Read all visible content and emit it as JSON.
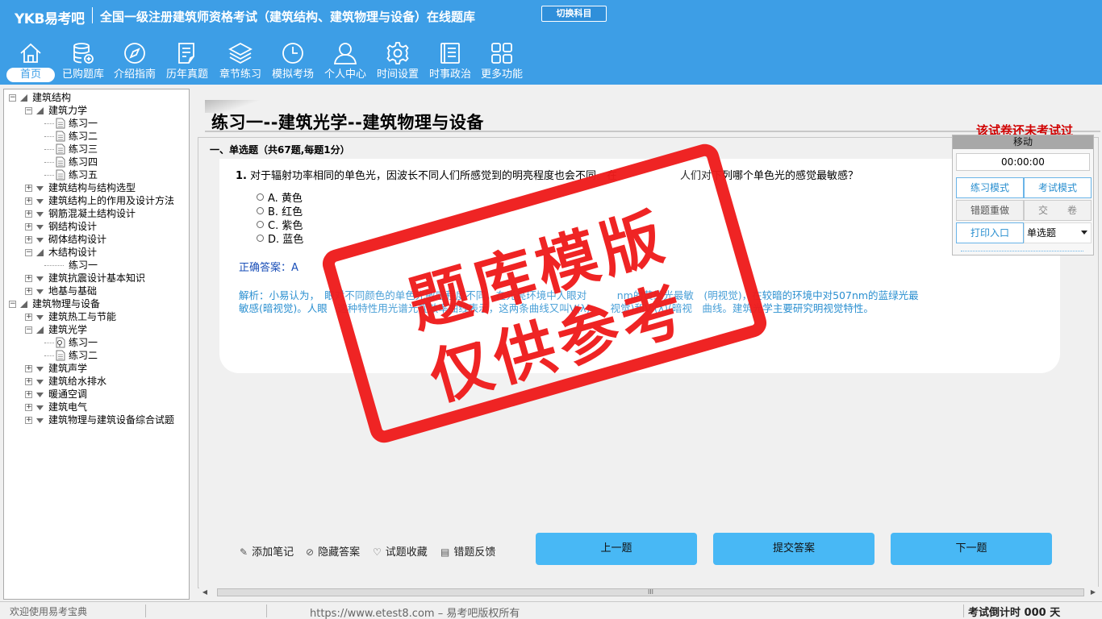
{
  "app": {
    "logo": "YKB易考吧",
    "title": "全国一级注册建筑师资格考试（建筑结构、建筑物理与设备）在线题库",
    "switch_label": "切换科目"
  },
  "nav": [
    {
      "label": "首页",
      "icon": "home-icon",
      "active": true
    },
    {
      "label": "已购题库",
      "icon": "database-icon"
    },
    {
      "label": "介绍指南",
      "icon": "compass-icon"
    },
    {
      "label": "历年真题",
      "icon": "document-list-icon"
    },
    {
      "label": "章节练习",
      "icon": "layers-icon"
    },
    {
      "label": "模拟考场",
      "icon": "clock-icon"
    },
    {
      "label": "个人中心",
      "icon": "user-icon"
    },
    {
      "label": "时间设置",
      "icon": "gear-icon"
    },
    {
      "label": "时事政治",
      "icon": "news-icon"
    },
    {
      "label": "更多功能",
      "icon": "grid-icon"
    }
  ],
  "tree": [
    {
      "label": "建筑结构",
      "level": 0,
      "expanded": true
    },
    {
      "label": "建筑力学",
      "level": 1,
      "expanded": true
    },
    {
      "label": "练习一",
      "level": 2,
      "leaf": true
    },
    {
      "label": "练习二",
      "level": 2,
      "leaf": true
    },
    {
      "label": "练习三",
      "level": 2,
      "leaf": true
    },
    {
      "label": "练习四",
      "level": 2,
      "leaf": true
    },
    {
      "label": "练习五",
      "level": 2,
      "leaf": true
    },
    {
      "label": "建筑结构与结构选型",
      "level": 1,
      "expanded": false
    },
    {
      "label": "建筑结构上的作用及设计方法",
      "level": 1,
      "expanded": false
    },
    {
      "label": "钢筋混凝土结构设计",
      "level": 1,
      "expanded": false
    },
    {
      "label": "钢结构设计",
      "level": 1,
      "expanded": false
    },
    {
      "label": "砌体结构设计",
      "level": 1,
      "expanded": false
    },
    {
      "label": "木结构设计",
      "level": 1,
      "expanded": true
    },
    {
      "label": "练习一",
      "level": 2,
      "leaf": true,
      "noicon": true
    },
    {
      "label": "建筑抗震设计基本知识",
      "level": 1,
      "expanded": false
    },
    {
      "label": "地基与基础",
      "level": 1,
      "expanded": false
    },
    {
      "label": "建筑物理与设备",
      "level": 0,
      "expanded": true
    },
    {
      "label": "建筑热工与节能",
      "level": 1,
      "expanded": false
    },
    {
      "label": "建筑光学",
      "level": 1,
      "expanded": true
    },
    {
      "label": "练习一",
      "level": 2,
      "leaf": true,
      "selected": true
    },
    {
      "label": "练习二",
      "level": 2,
      "leaf": true
    },
    {
      "label": "建筑声学",
      "level": 1,
      "expanded": false
    },
    {
      "label": "建筑给水排水",
      "level": 1,
      "expanded": false
    },
    {
      "label": "暖通空调",
      "level": 1,
      "expanded": false
    },
    {
      "label": "建筑电气",
      "level": 1,
      "expanded": false
    },
    {
      "label": "建筑物理与建筑设备综合试题",
      "level": 1,
      "expanded": false
    }
  ],
  "paper": {
    "title": "练习一--建筑光学--建筑物理与设备",
    "status": "该试卷还未考试过",
    "section": "一、单选题（共67题,每题1分）"
  },
  "question": {
    "number": "1.",
    "text": "对于辐射功率相同的单色光，因波长不同人们所感觉到的明亮程度也会不同。在",
    "text_tail": "人们对下列哪个单色光的感觉最敏感？",
    "options": [
      "A. 黄色",
      "B. 红色",
      "C. 紫色",
      "D. 蓝色"
    ],
    "answer_label": "正确答案：",
    "answer_value": "A",
    "analysis_line1": "解析：小易认为，　眼对不同颜色的单色光敏感程度不同，在光亮环境中人眼对　　　nm的黄绿光最敏　(明视觉)，在较暗的环境中对507nm的蓝绿光最",
    "analysis_line2": "敏感(暗视觉)。人眼　这种特性用光谱光视效率曲线表示，这两条曲线又叫V(λ)　　视觉)和V'(λ)(暗视　曲线。建筑光学主要研究明视觉特性。"
  },
  "actions": {
    "note": "添加笔记",
    "hide_answer": "隐藏答案",
    "favorite": "试题收藏",
    "feedback": "错题反馈",
    "prev": "上一题",
    "submit_answer": "提交答案",
    "next": "下一题"
  },
  "panel": {
    "header": "移动",
    "timer": "00:00:00",
    "practice_mode": "练习模式",
    "exam_mode": "考试模式",
    "redo_wrong": "错题重做",
    "hand_in": "交　　卷",
    "print": "打印入口",
    "type_select": "单选题"
  },
  "stamp": {
    "line1": "题库模版",
    "line2": "仅供参考"
  },
  "status": {
    "welcome": "欢迎使用易考宝典",
    "copyright": "https://www.etest8.com – 易考吧版权所有",
    "countdown": "考试倒计时 000 天"
  },
  "colors": {
    "header": "#3d9ee6",
    "answer": "#1a4fb8",
    "analysis": "#2a8fd0",
    "warning": "#d00000",
    "button": "#48b8f5",
    "stamp": "#ef1c1c"
  }
}
